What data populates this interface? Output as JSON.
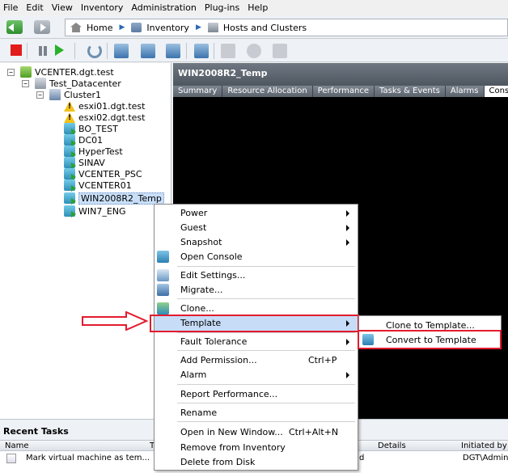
{
  "menubar": [
    "File",
    "Edit",
    "View",
    "Inventory",
    "Administration",
    "Plug-ins",
    "Help"
  ],
  "breadcrumb": {
    "home": "Home",
    "inventory": "Inventory",
    "location": "Hosts and Clusters"
  },
  "tree": {
    "vcenter": "VCENTER.dgt.test",
    "datacenter": "Test_Datacenter",
    "cluster": "Cluster1",
    "hosts": [
      "esxi01.dgt.test",
      "esxi02.dgt.test"
    ],
    "vms": [
      "BO_TEST",
      "DC01",
      "HyperTest",
      "SINAV",
      "VCENTER_PSC",
      "VCENTER01",
      "WIN2008R2_Temp",
      "WIN7_ENG"
    ],
    "selected": "WIN2008R2_Temp"
  },
  "panel": {
    "title": "WIN2008R2_Temp",
    "tabs": [
      "Summary",
      "Resource Allocation",
      "Performance",
      "Tasks & Events",
      "Alarms",
      "Conso"
    ],
    "active_tab": "Conso"
  },
  "context_menu": {
    "power": "Power",
    "guest": "Guest",
    "snapshot": "Snapshot",
    "open_console": "Open Console",
    "edit_settings": "Edit Settings...",
    "migrate": "Migrate...",
    "clone": "Clone...",
    "template": "Template",
    "fault_tolerance": "Fault Tolerance",
    "add_permission": "Add Permission...",
    "add_permission_key": "Ctrl+P",
    "alarm": "Alarm",
    "report_performance": "Report Performance...",
    "rename": "Rename",
    "open_new_window": "Open in New Window...",
    "open_new_window_key": "Ctrl+Alt+N",
    "remove_inventory": "Remove from Inventory",
    "delete_disk": "Delete from Disk"
  },
  "submenu": {
    "clone_to_template": "Clone to Template...",
    "convert_to_template": "Convert to Template"
  },
  "tasks": {
    "title": "Recent Tasks",
    "columns": {
      "name": "Name",
      "target": "T",
      "details": "Details",
      "initiated_by": "Initiated by"
    },
    "row": {
      "name": "Mark virtual machine as tem...",
      "status": "d",
      "initiated_by": "DGT\\Admin"
    }
  },
  "colors": {
    "highlight_box": "#e31b2e",
    "menu_hover": "#c7dcf7",
    "panel_bg": "#000000"
  }
}
